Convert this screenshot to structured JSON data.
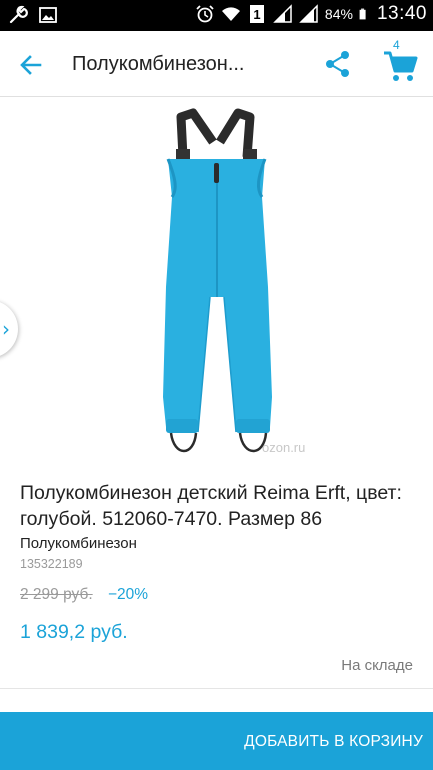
{
  "status_bar": {
    "battery": "84%",
    "time": "13:40",
    "icons": [
      "wrench-icon",
      "image-icon",
      "alarm-icon",
      "wifi-icon",
      "sim-1-icon",
      "signal-icon",
      "signal-icon",
      "battery-icon"
    ]
  },
  "app_bar": {
    "title": "Полукомбинезон...",
    "cart_count": "4",
    "icons": [
      "back-arrow-icon",
      "share-icon",
      "cart-icon"
    ],
    "accent": "#1ba3d8"
  },
  "gallery": {
    "watermark": "ozon.ru",
    "product_color": "#2ab0e0"
  },
  "product": {
    "title": "Полукомбинезон детский Reima Erft, цвет: голубой. 512060-7470. Размер 86",
    "category": "Полукомбинезон",
    "sku": "135322189",
    "old_price": "2 299 руб.",
    "discount": "−20%",
    "price": "1 839,2 руб.",
    "availability": "На складе"
  },
  "bottom_bar": {
    "add_to_cart": "ДОБАВИТЬ В КОРЗИНУ",
    "background": "#1ba3d8"
  }
}
